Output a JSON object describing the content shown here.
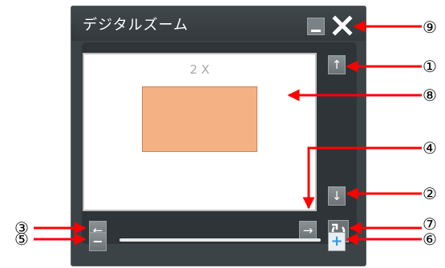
{
  "window": {
    "title": "デジタルズーム",
    "zoom_label": "2 X"
  },
  "controls": {
    "up_glyph": "↑",
    "down_glyph": "↓",
    "left_glyph": "←",
    "right_glyph": "→",
    "minus_glyph": "−",
    "plus_glyph": "+",
    "zoom_slider_level": 0.0
  },
  "annotations": {
    "n1": "①",
    "n2": "②",
    "n3": "③",
    "n4": "④",
    "n5": "⑤",
    "n6": "⑥",
    "n7": "⑦",
    "n8": "⑧",
    "n9": "⑨"
  },
  "colors": {
    "panel": "#3c4347",
    "zoom_region": "#f4b183",
    "annotation_arrow": "#ff0000",
    "plus_icon": "#2f9be0"
  },
  "icons": {
    "close": "close-x-icon",
    "minimize": "minimize-icon",
    "reset": "rotate-reset-icon"
  }
}
